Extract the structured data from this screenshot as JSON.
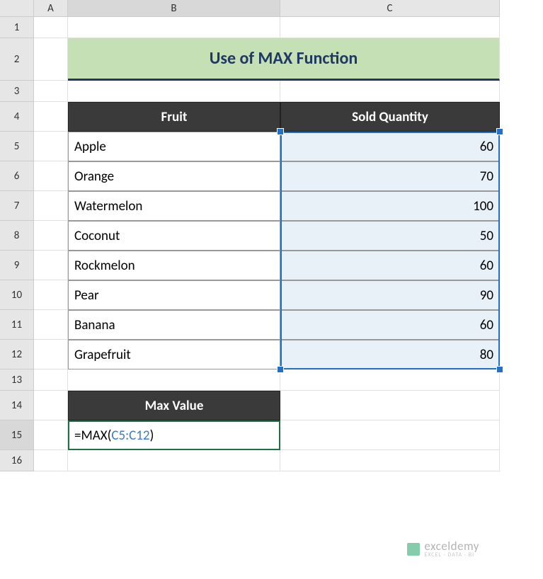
{
  "columns": {
    "A": "A",
    "B": "B",
    "C": "C"
  },
  "rows": [
    "1",
    "2",
    "3",
    "4",
    "5",
    "6",
    "7",
    "8",
    "9",
    "10",
    "11",
    "12",
    "13",
    "14",
    "15",
    "16"
  ],
  "title": "Use of MAX Function",
  "headers": {
    "fruit": "Fruit",
    "qty": "Sold Quantity"
  },
  "data": [
    {
      "fruit": "Apple",
      "qty": "60"
    },
    {
      "fruit": "Orange",
      "qty": "70"
    },
    {
      "fruit": "Watermelon",
      "qty": "100"
    },
    {
      "fruit": "Coconut",
      "qty": "50"
    },
    {
      "fruit": "Rockmelon",
      "qty": "60"
    },
    {
      "fruit": "Pear",
      "qty": "90"
    },
    {
      "fruit": "Banana",
      "qty": "60"
    },
    {
      "fruit": "Grapefruit",
      "qty": "80"
    }
  ],
  "maxValueHeader": "Max Value",
  "formula": {
    "prefix": "=MAX(",
    "ref": "C5:C12",
    "suffix": ")"
  },
  "watermark": {
    "brand": "exceldemy",
    "tag": "EXCEL · DATA · BI"
  }
}
